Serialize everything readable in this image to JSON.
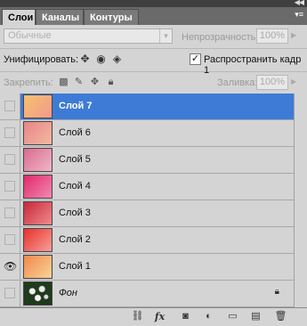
{
  "tabs": [
    {
      "label": "Слои"
    },
    {
      "label": "Каналы"
    },
    {
      "label": "Контуры"
    }
  ],
  "blend": {
    "mode": "Обычные"
  },
  "opacity": {
    "label": "Непрозрачность:",
    "value": "100%"
  },
  "unify": {
    "label": "Унифицировать:"
  },
  "propagate": {
    "label": "Распространить кадр 1",
    "checked": true
  },
  "lock": {
    "label": "Закрепить:"
  },
  "fill": {
    "label": "Заливка:",
    "value": "100%"
  },
  "layers": [
    {
      "name": "Слой 7",
      "visible": false,
      "selected": true,
      "gradient": [
        "#f6c06f",
        "#f39a8a"
      ]
    },
    {
      "name": "Слой 6",
      "visible": false,
      "selected": false,
      "gradient": [
        "#e8858a",
        "#f3b8a0"
      ]
    },
    {
      "name": "Слой 5",
      "visible": false,
      "selected": false,
      "gradient": [
        "#d96a8f",
        "#f0b7c8"
      ]
    },
    {
      "name": "Слой 4",
      "visible": false,
      "selected": false,
      "gradient": [
        "#e2286a",
        "#f08ab0"
      ]
    },
    {
      "name": "Слой 3",
      "visible": false,
      "selected": false,
      "gradient": [
        "#c8283a",
        "#f08a8c"
      ]
    },
    {
      "name": "Слой 2",
      "visible": false,
      "selected": false,
      "gradient": [
        "#e8302a",
        "#f5a09a"
      ]
    },
    {
      "name": "Слой 1",
      "visible": true,
      "selected": false,
      "gradient": [
        "#f0884a",
        "#f8d49a"
      ]
    },
    {
      "name": "Фон",
      "visible": false,
      "selected": false,
      "locked": true,
      "photo": true
    }
  ],
  "colors": {
    "selection": "#3d7bd6",
    "panel": "#d4d4d4"
  }
}
